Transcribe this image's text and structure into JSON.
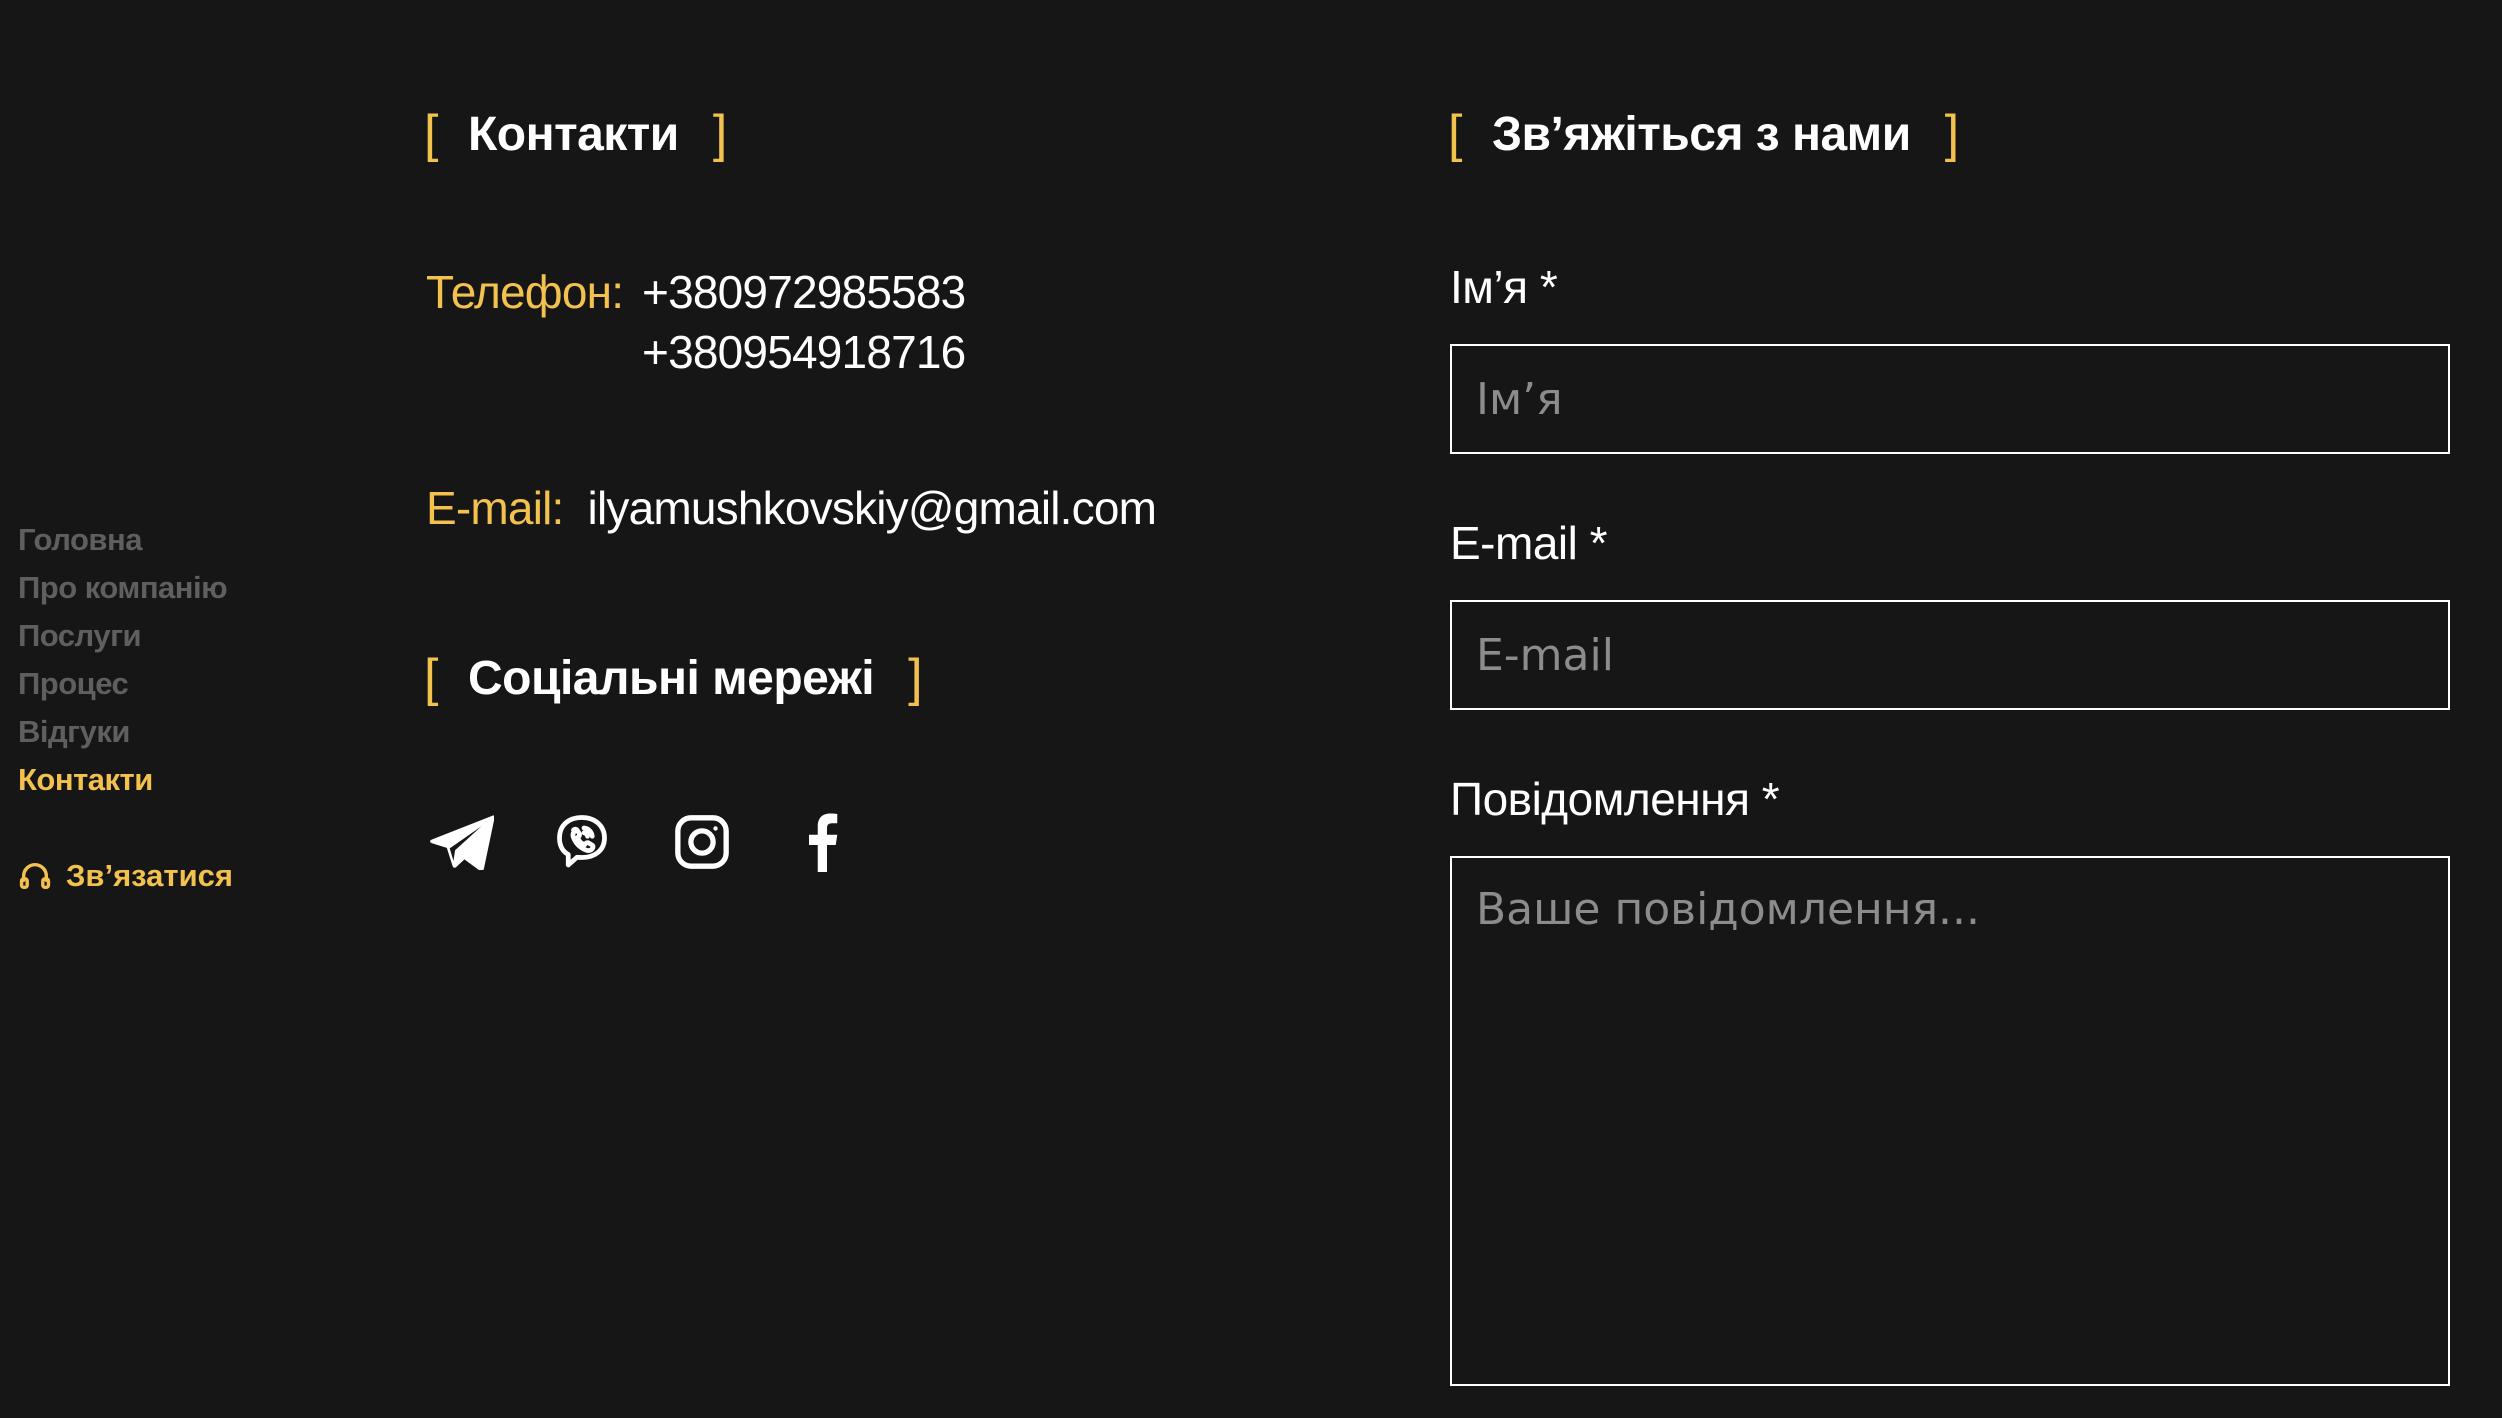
{
  "sidebar": {
    "nav": [
      {
        "label": "Головна",
        "active": false
      },
      {
        "label": "Про компанію",
        "active": false
      },
      {
        "label": "Послуги",
        "active": false
      },
      {
        "label": "Процес",
        "active": false
      },
      {
        "label": "Відгуки",
        "active": false
      },
      {
        "label": "Контакти",
        "active": true
      }
    ],
    "cta_label": "Зв’язатися",
    "cta_icon": "headset-icon"
  },
  "contacts": {
    "heading": "Контакти",
    "phone_label": "Телефон:",
    "phones": [
      "+380972985583",
      "+380954918716"
    ],
    "email_label": "E-mail:",
    "email": "ilyamushkovskiy@gmail.com"
  },
  "socials": {
    "heading": "Соціальні мережі",
    "icons": [
      "telegram-icon",
      "viber-icon",
      "instagram-icon",
      "facebook-icon"
    ]
  },
  "form": {
    "heading": "Зв’яжіться з нами",
    "name_label": "Ім’я *",
    "name_placeholder": "Ім’я",
    "name_value": "",
    "email_label": "E-mail *",
    "email_placeholder": "E-mail",
    "email_value": "",
    "message_label": "Повідомлення *",
    "message_placeholder": "Ваше повідомлення...",
    "message_value": ""
  },
  "colors": {
    "background": "#161617",
    "accent": "#f2c14e",
    "text": "#ffffff",
    "muted_nav": "#5f5f5f",
    "placeholder": "#8c8c8c"
  },
  "brackets": {
    "open": "[",
    "close": "]"
  }
}
